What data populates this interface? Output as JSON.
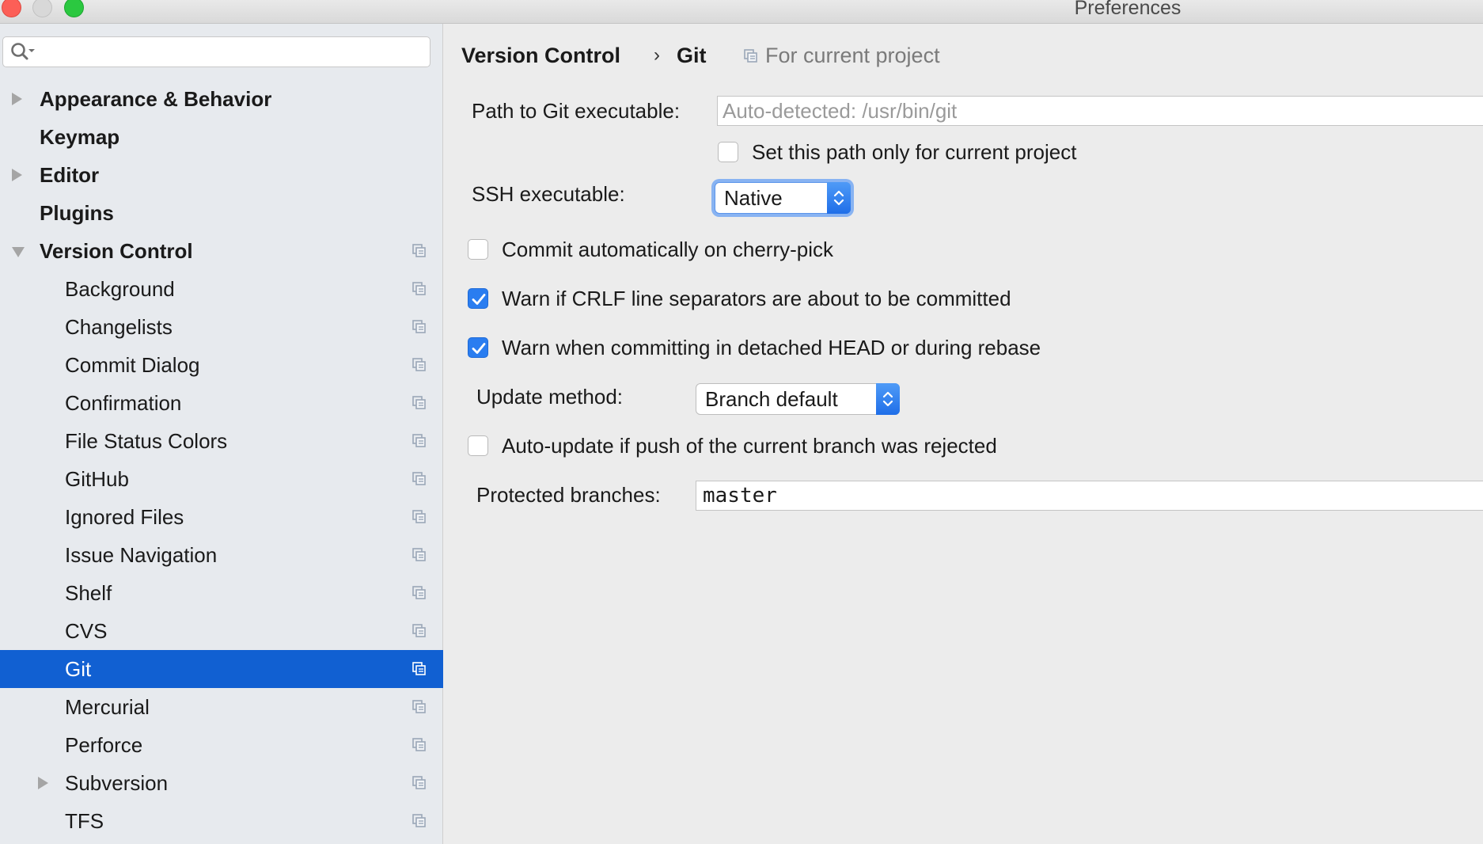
{
  "window": {
    "title": "Preferences"
  },
  "sidebar": {
    "search": {
      "value": "",
      "placeholder": ""
    },
    "items": [
      {
        "label": "Appearance & Behavior",
        "bold": true,
        "arrow": "right"
      },
      {
        "label": "Keymap",
        "bold": true
      },
      {
        "label": "Editor",
        "bold": true,
        "arrow": "right"
      },
      {
        "label": "Plugins",
        "bold": true
      },
      {
        "label": "Version Control",
        "bold": true,
        "arrow": "down",
        "project_icon": true
      },
      {
        "label": "Background",
        "project_icon": true
      },
      {
        "label": "Changelists",
        "project_icon": true
      },
      {
        "label": "Commit Dialog",
        "project_icon": true
      },
      {
        "label": "Confirmation",
        "project_icon": true
      },
      {
        "label": "File Status Colors",
        "project_icon": true
      },
      {
        "label": "GitHub",
        "project_icon": true
      },
      {
        "label": "Ignored Files",
        "project_icon": true
      },
      {
        "label": "Issue Navigation",
        "project_icon": true
      },
      {
        "label": "Shelf",
        "project_icon": true
      },
      {
        "label": "CVS",
        "project_icon": true
      },
      {
        "label": "Git",
        "project_icon": true,
        "selected": true
      },
      {
        "label": "Mercurial",
        "project_icon": true
      },
      {
        "label": "Perforce",
        "project_icon": true
      },
      {
        "label": "Subversion",
        "project_icon": true,
        "arrow": "right"
      },
      {
        "label": "TFS",
        "project_icon": true
      }
    ]
  },
  "breadcrumb": {
    "parent": "Version Control",
    "separator": "›",
    "current": "Git",
    "scope": "For current project"
  },
  "git": {
    "path_label": "Path to Git executable:",
    "path_value": "",
    "path_placeholder": "Auto-detected: /usr/bin/git",
    "path_current_project_label": "Set this path only for current project",
    "path_current_project_checked": false,
    "ssh_label": "SSH executable:",
    "ssh_value": "Native",
    "cherry_pick_label": "Commit automatically on cherry-pick",
    "cherry_pick_checked": false,
    "crlf_label": "Warn if CRLF line separators are about to be committed",
    "crlf_checked": true,
    "detached_label": "Warn when committing in detached HEAD or during rebase",
    "detached_checked": true,
    "update_method_label": "Update method:",
    "update_method_value": "Branch default",
    "auto_update_label": "Auto-update if push of the current branch was rejected",
    "auto_update_checked": false,
    "protected_label": "Protected branches:",
    "protected_value": "master"
  },
  "colors": {
    "selection": "#1160d2",
    "checkbox_checked": "#2a7df0",
    "sidebar_bg": "#e7eaee",
    "content_bg": "#ececec"
  }
}
